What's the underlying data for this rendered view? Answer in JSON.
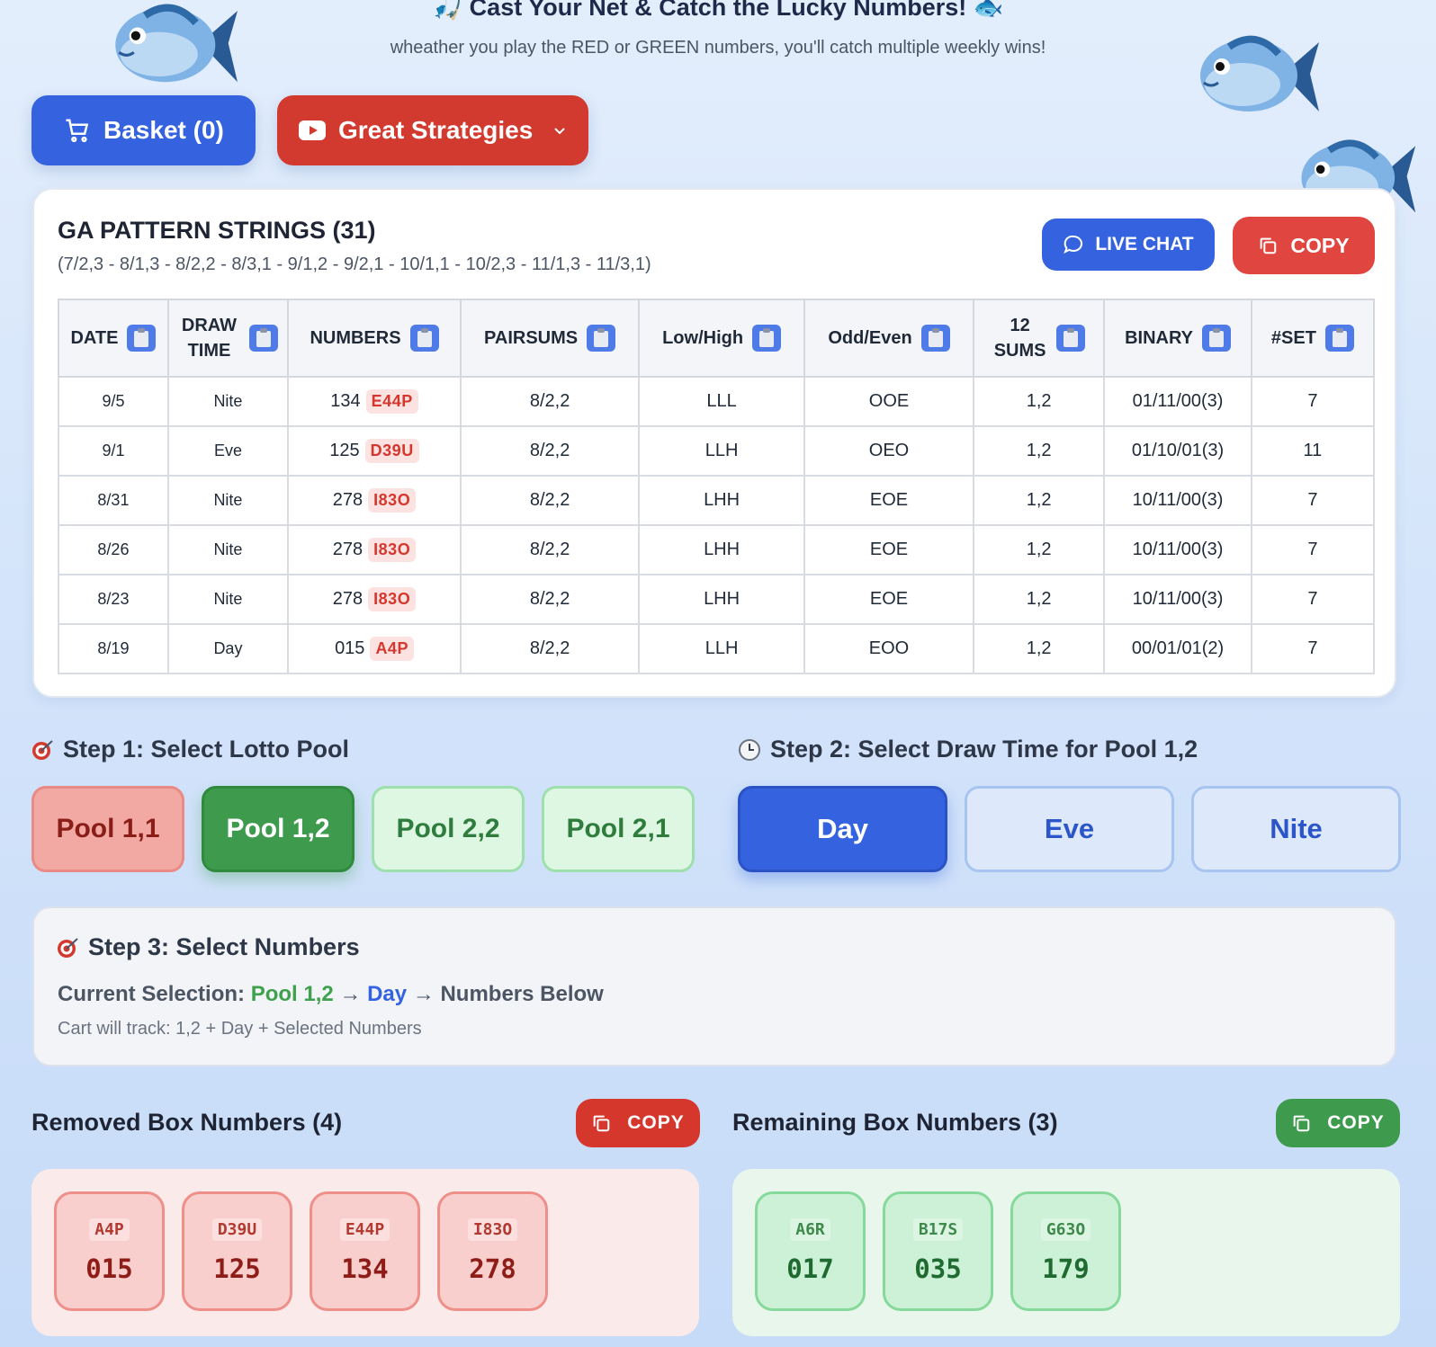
{
  "header": {
    "title": "🎣 Cast Your Net & Catch the Lucky Numbers! 🐟",
    "subtitle": "wheather you play the RED or GREEN numbers, you'll catch multiple weekly wins!"
  },
  "top_buttons": {
    "basket_label": "Basket (0)",
    "strategies_label": "Great Strategies"
  },
  "pattern_card": {
    "title": "GA PATTERN STRINGS (31)",
    "subtitle": "(7/2,3 - 8/1,3 - 8/2,2 - 8/3,1 - 9/1,2 - 9/2,1 - 10/1,1 - 10/2,3 - 11/1,3 - 11/3,1)",
    "live_chat_label": "LIVE CHAT",
    "copy_label": "COPY",
    "columns": [
      "DATE",
      "DRAW TIME",
      "NUMBERS",
      "PAIRSUMS",
      "Low/High",
      "Odd/Even",
      "12 SUMS",
      "BINARY",
      "#SET"
    ],
    "rows": [
      {
        "date": "9/5",
        "draw": "Nite",
        "number": "134",
        "tag": "E44P",
        "pairsums": "8/2,2",
        "lowhigh": "LLL",
        "oddeven": "OOE",
        "sums": "1,2",
        "binary": "01/11/00(3)",
        "set": "7"
      },
      {
        "date": "9/1",
        "draw": "Eve",
        "number": "125",
        "tag": "D39U",
        "pairsums": "8/2,2",
        "lowhigh": "LLH",
        "oddeven": "OEO",
        "sums": "1,2",
        "binary": "01/10/01(3)",
        "set": "11"
      },
      {
        "date": "8/31",
        "draw": "Nite",
        "number": "278",
        "tag": "I83O",
        "pairsums": "8/2,2",
        "lowhigh": "LHH",
        "oddeven": "EOE",
        "sums": "1,2",
        "binary": "10/11/00(3)",
        "set": "7"
      },
      {
        "date": "8/26",
        "draw": "Nite",
        "number": "278",
        "tag": "I83O",
        "pairsums": "8/2,2",
        "lowhigh": "LHH",
        "oddeven": "EOE",
        "sums": "1,2",
        "binary": "10/11/00(3)",
        "set": "7"
      },
      {
        "date": "8/23",
        "draw": "Nite",
        "number": "278",
        "tag": "I83O",
        "pairsums": "8/2,2",
        "lowhigh": "LHH",
        "oddeven": "EOE",
        "sums": "1,2",
        "binary": "10/11/00(3)",
        "set": "7"
      },
      {
        "date": "8/19",
        "draw": "Day",
        "number": "015",
        "tag": "A4P",
        "pairsums": "8/2,2",
        "lowhigh": "LLH",
        "oddeven": "EOO",
        "sums": "1,2",
        "binary": "00/01/01(2)",
        "set": "7"
      }
    ]
  },
  "step1": {
    "title": "Step 1: Select Lotto Pool",
    "pools": [
      "Pool 1,1",
      "Pool 1,2",
      "Pool 2,2",
      "Pool 2,1"
    ],
    "selected": "Pool 1,2"
  },
  "step2": {
    "title": "Step 2: Select Draw Time for Pool 1,2",
    "times": [
      "Day",
      "Eve",
      "Nite"
    ],
    "selected": "Day"
  },
  "step3": {
    "title": "Step 3: Select Numbers",
    "current_label": "Current Selection:",
    "pool": "Pool 1,2",
    "arrow1": "→",
    "draw": "Day",
    "rest": "→ Numbers Below",
    "cart_text": "Cart will track: 1,2 + Day + Selected Numbers"
  },
  "removed": {
    "title": "Removed Box Numbers (4)",
    "copy_label": "COPY",
    "items": [
      {
        "code": "A4P",
        "num": "015"
      },
      {
        "code": "D39U",
        "num": "125"
      },
      {
        "code": "E44P",
        "num": "134"
      },
      {
        "code": "I83O",
        "num": "278"
      }
    ]
  },
  "remaining": {
    "title": "Remaining Box Numbers (3)",
    "copy_label": "COPY",
    "items": [
      {
        "code": "A6R",
        "num": "017"
      },
      {
        "code": "B17S",
        "num": "035"
      },
      {
        "code": "G63O",
        "num": "179"
      }
    ]
  },
  "colors": {
    "primary_blue": "#3563e0",
    "red": "#d23a2f",
    "green": "#3e9a4c"
  },
  "icons": [
    "cart-icon",
    "youtube-icon",
    "chevron-down-icon",
    "chat-icon",
    "copy-icon",
    "clipboard-icon",
    "target-icon",
    "clock-icon",
    "fish-icon"
  ]
}
